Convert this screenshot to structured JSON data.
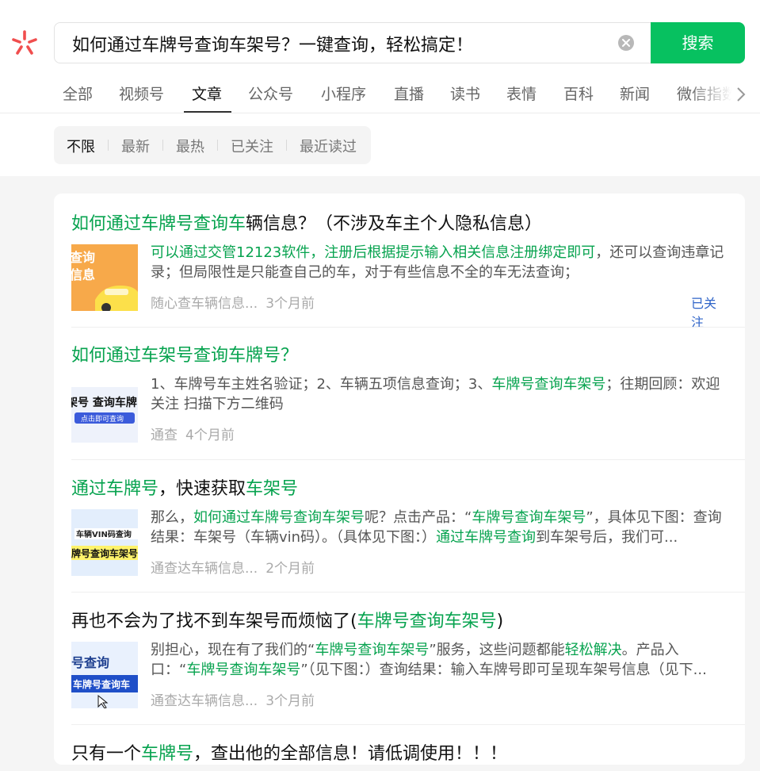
{
  "search": {
    "query": "如何通过车牌号查询车架号？一键查询，轻松搞定！",
    "button_label": "搜索"
  },
  "tabs": [
    {
      "label": "全部"
    },
    {
      "label": "视频号"
    },
    {
      "label": "文章",
      "active": true
    },
    {
      "label": "公众号"
    },
    {
      "label": "小程序"
    },
    {
      "label": "直播"
    },
    {
      "label": "读书"
    },
    {
      "label": "表情"
    },
    {
      "label": "百科"
    },
    {
      "label": "新闻"
    },
    {
      "label": "微信指数"
    }
  ],
  "filters": [
    {
      "label": "不限",
      "active": true
    },
    {
      "label": "最新"
    },
    {
      "label": "最热"
    },
    {
      "label": "已关注"
    },
    {
      "label": "最近读过"
    }
  ],
  "results": [
    {
      "title_hl": "如何通过车牌号查询车",
      "title_rest": "辆信息？（不涉及车主个人隐私信息）",
      "snippet_hl": "可以通过交管12123软件，注册后根据提示输入相关信息注册绑定即可",
      "snippet_rest": "，还可以查询违章记录；但局限性是只能查自己的车，对于有些信息不全的车无法查询；",
      "source": "随心查车辆信息...",
      "time": "3个月前",
      "tag": "已关注",
      "thumb_text": [
        "查询",
        "信息"
      ]
    },
    {
      "title_hl": "如何通过车架号查询车牌号？",
      "snippet_a": "1、车牌号车主姓名验证；2、车辆五项信息查询；3、",
      "snippet_hl": "车牌号查询车架号",
      "snippet_b": "；往期回顾：欢迎关注 扫描下方二维码",
      "source": "通查",
      "time": "4个月前",
      "thumb_text": [
        "架号 查询车牌",
        "点击即可查询"
      ]
    },
    {
      "title_hl1": "通过车牌号",
      "title_mid": "，快速获取",
      "title_hl2": "车架号",
      "snippet_a": "那么，",
      "snippet_hl1": "如何通过车牌号查询车架号",
      "snippet_b": "呢？点击产品：“",
      "snippet_hl2": "车牌号查询车架号",
      "snippet_c": "”，具体见下图：查询结果：车架号（车辆vin码）。（具体见下图：）",
      "snippet_hl3": "通过车牌号查询",
      "snippet_d": "到车架号后，我们可...",
      "source": "通查达车辆信息...",
      "time": "2个月前",
      "thumb_text": [
        "车辆VIN码查询",
        "牌号查询车架号"
      ]
    },
    {
      "title_a": "再也不会为了找不到车架号而烦恼了(",
      "title_hl": "车牌号查询车架号",
      "title_b": ")",
      "snippet_a": "别担心，现在有了我们的“",
      "snippet_hl1": "车牌号查询车架号",
      "snippet_b": "”服务，这些问题都能",
      "snippet_hl2": "轻松解决",
      "snippet_c": "。产品入口：“",
      "snippet_hl3": "车牌号查询车架号",
      "snippet_d": "”（见下图：）查询结果：输入车牌号即可呈现车架号信息（见下...",
      "source": "通查达车辆信息...",
      "time": "3个月前",
      "thumb_text": [
        "号查询",
        "车牌号查询车"
      ]
    },
    {
      "title_a": "只有一个",
      "title_hl": "车牌号",
      "title_b": "，查出他的全部信息！请低调使用！！！"
    }
  ]
}
